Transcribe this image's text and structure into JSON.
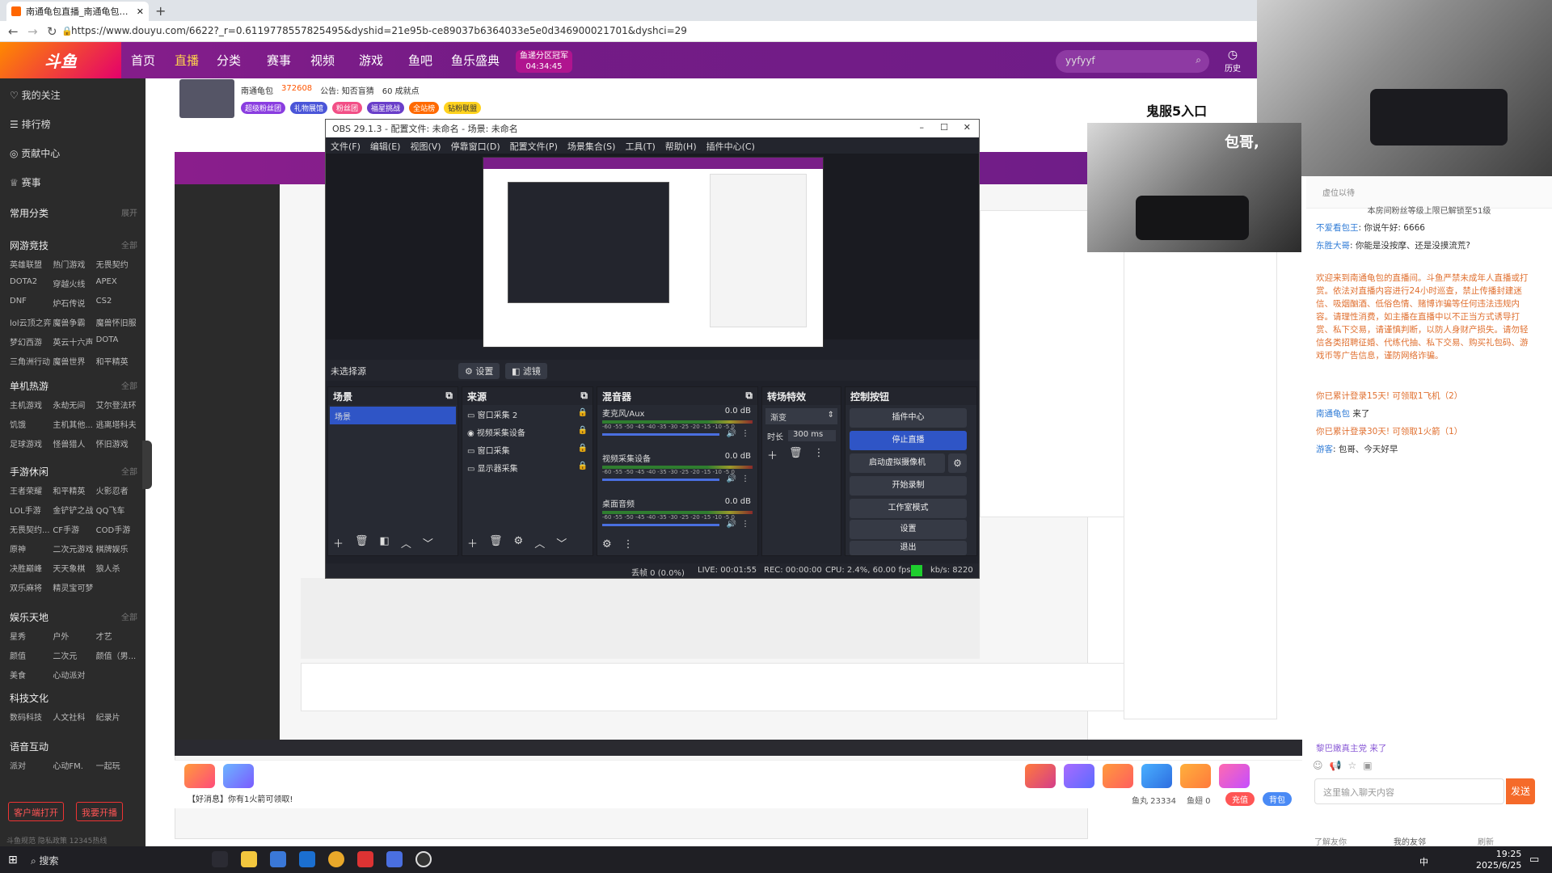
{
  "browser": {
    "tab_title": "南通龟包直播_南通龟包直播...",
    "new_tab": "+",
    "url": "https://www.douyu.com/6622?_r=0.6119778557825495&dyshid=21e95b-ce89037b6364033e5e0d346900021701&dyshci=29"
  },
  "header": {
    "nav": [
      "首页",
      "直播",
      "分类",
      "赛事",
      "视频",
      "游戏",
      "鱼吧",
      "鱼乐盛典"
    ],
    "active_nav": "直播",
    "badge_line1": "鱼递分区冠军",
    "badge_line2": "04:34:45",
    "search_value": "yyfyyf",
    "history": "历史"
  },
  "room": {
    "name": "南通龟包",
    "hot": "372608",
    "notice": "公告: 知否盲猜",
    "watching": "60 成就点",
    "brand": "鬼服5入口",
    "tags": [
      "超级粉丝团",
      "礼物展馆",
      "粉丝团",
      "福星挑战",
      "全站榜",
      "钻粉联盟"
    ]
  },
  "sidebar": {
    "top_items": [
      "我的关注",
      "排行榜",
      "贡献中心",
      "赛事"
    ],
    "sections": [
      {
        "title": "常用分类",
        "more": "展开",
        "items": []
      },
      {
        "title": "网游竞技",
        "more": "全部",
        "items": [
          "英雄联盟",
          "热门游戏",
          "无畏契约",
          "DOTA2",
          "穿越火线",
          "APEX",
          "DNF",
          "炉石传说",
          "CS2",
          "lol云顶之弈",
          "魔兽争霸",
          "魔兽怀旧服",
          "梦幻西游",
          "英云十六声",
          "DOTA",
          "三角洲行动",
          "魔兽世界",
          "和平精英"
        ]
      },
      {
        "title": "单机热游",
        "more": "全部",
        "items": [
          "主机游戏",
          "永劫无间",
          "艾尔登法环",
          "饥饿",
          "主机其他...",
          "逃离塔科夫",
          "足球游戏",
          "怪兽猎人",
          "怀旧游戏"
        ]
      },
      {
        "title": "手游休闲",
        "more": "全部",
        "items": [
          "王者荣耀",
          "和平精英",
          "火影忍者",
          "LOL手游",
          "金铲铲之战",
          "QQ飞车",
          "无畏契约...",
          "CF手游",
          "COD手游",
          "原神",
          "二次元游戏",
          "棋牌娱乐",
          "决胜巅峰",
          "天天象棋",
          "狼人杀",
          "双乐麻将",
          "精灵宝可梦"
        ]
      },
      {
        "title": "娱乐天地",
        "more": "全部",
        "items": [
          "星秀",
          "户外",
          "才艺",
          "颜值",
          "二次元",
          "颜值（男...",
          "美食",
          "心动派对"
        ]
      },
      {
        "title": "科技文化",
        "more": "",
        "items": [
          "数码科技",
          "人文社科",
          "纪录片"
        ]
      },
      {
        "title": "语音互动",
        "more": "",
        "items": [
          "派对",
          "心动FM.",
          "一起玩"
        ]
      }
    ],
    "btn_client": "客户端打开",
    "btn_live": "我要开播",
    "footer": "斗鱼规范   隐私政策   12345热线"
  },
  "obs": {
    "title": "OBS 29.1.3 - 配置文件: 未命名 - 场景: 未命名",
    "menu": [
      "文件(F)",
      "编辑(E)",
      "视图(V)",
      "停靠窗口(D)",
      "配置文件(P)",
      "场景集合(S)",
      "工具(T)",
      "帮助(H)",
      "插件中心(C)"
    ],
    "no_source": "未选择源",
    "properties": "设置",
    "filters": "滤镜",
    "scenes_title": "场景",
    "scene_items": [
      "场景"
    ],
    "sources_title": "来源",
    "sources": [
      "窗口采集 2",
      "视频采集设备",
      "窗口采集",
      "显示器采集"
    ],
    "mixer_title": "混音器",
    "mixer": [
      {
        "name": "麦克风/Aux",
        "db": "0.0 dB"
      },
      {
        "name": "视频采集设备",
        "db": "0.0 dB"
      },
      {
        "name": "桌面音频",
        "db": "0.0 dB"
      }
    ],
    "meter_scale": "-60 -55 -50 -45 -40 -35 -30 -25 -20 -15 -10 -5 0",
    "transition_title": "转场特效",
    "transition": "渐变",
    "duration_label": "时长",
    "duration": "300 ms",
    "controls_title": "控制按钮",
    "controls": [
      "插件中心",
      "停止直播",
      "启动虚拟摄像机",
      "开始录制",
      "工作室模式",
      "设置",
      "退出"
    ],
    "status": {
      "dropped": "丢帧 0 (0.0%)",
      "live": "LIVE: 00:01:55",
      "rec": "REC: 00:00:00",
      "cpu": "CPU: 2.4%, 60.00 fps",
      "kbps": "kb/s: 8220"
    }
  },
  "cam": {
    "caption": "包哥,"
  },
  "chat": {
    "header": "虚位以待",
    "notice": "本房间粉丝等级上限已解锁至51级",
    "messages": [
      {
        "nick": "不爱看包王",
        "text": "你说午好: 6666"
      },
      {
        "nick": "东胜大哥",
        "text": "你能是没按摩、还是没摸流荒?"
      },
      {
        "nick": "",
        "text": "欢迎来到南通龟包的直播间。斗鱼严禁未成年人直播或打赏。依法对直播内容进行24小时巡查，禁止传播封建迷信、吸烟酗酒、低俗色情、赌博诈骗等任何违法违规内容。请理性消费，如主播在直播中以不正当方式诱导打赏、私下交易，请谨慎判断，以防人身财产损失。请勿轻信各类招聘征婚、代练代抽、私下交易、购买礼包码、游戏币等广告信息，谨防网络诈骗。"
      },
      {
        "nick": "",
        "text": "你已累计登录15天! 可领取1飞机（2）"
      },
      {
        "nick": "南通龟包",
        "text": "来了"
      },
      {
        "nick": "",
        "text": "你已累计登录30天! 可领取1火箭（1）"
      },
      {
        "nick": "游客",
        "text": "包哥、今天好早"
      }
    ],
    "enter_msg": "黎巴嫩真主党 来了",
    "input_placeholder": "这里输入聊天内容",
    "send": "发送",
    "footer_left": "了解友你",
    "footer_mid": "我的友邻",
    "footer_right": "刷新"
  },
  "stream_bottom": {
    "fish": "鱼丸 23334",
    "fishball": "鱼翅 0",
    "recharge": "充值",
    "backpack": "背包",
    "gift_hint": "【好消息】你有1火箭可领取!"
  },
  "taskbar": {
    "search": "搜索",
    "time": "19:25",
    "date": "2025/6/25",
    "ime": "中"
  }
}
